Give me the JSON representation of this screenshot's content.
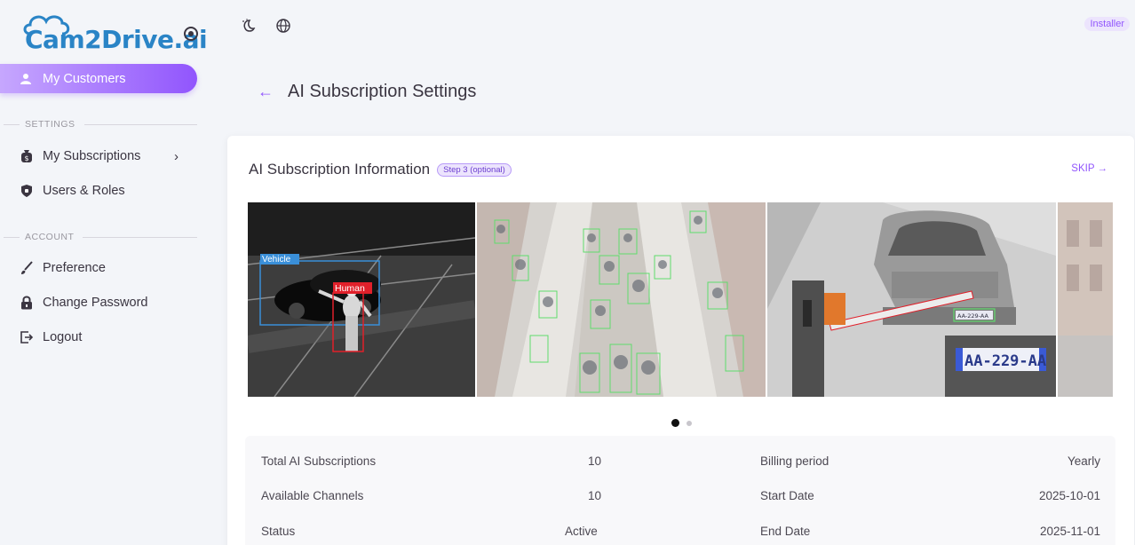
{
  "sidebar": {
    "logo_text": "Cam2Drive.ai",
    "active_item": "My Customers",
    "settings_label": "SETTINGS",
    "account_label": "ACCOUNT",
    "items": [
      {
        "label": "My Subscriptions",
        "icon": "money-bag-icon"
      },
      {
        "label": "Users & Roles",
        "icon": "shield-icon"
      },
      {
        "label": "Preference",
        "icon": "brush-icon"
      },
      {
        "label": "Change Password",
        "icon": "lock-icon"
      },
      {
        "label": "Logout",
        "icon": "logout-icon"
      }
    ]
  },
  "topbar": {
    "role_badge": "Installer"
  },
  "page": {
    "title": "AI Subscription Settings"
  },
  "card": {
    "title": "AI Subscription Information",
    "step_badge": "Step 3 (optional)",
    "skip_label": "SKIP →",
    "slides": [
      {
        "labels": [
          "Vehicle",
          "Human"
        ]
      },
      {
        "labels": []
      },
      {
        "labels": [
          "AA-229-AA"
        ]
      }
    ],
    "info": {
      "rows": [
        {
          "label1": "Total AI Subscriptions",
          "value1": "10",
          "label2": "Billing period",
          "value2": "Yearly"
        },
        {
          "label1": "Available Channels",
          "value1": "10",
          "label2": "Start Date",
          "value2": "2025-10-01"
        },
        {
          "label1": "Status",
          "value1": "Active",
          "label2": "End Date",
          "value2": "2025-11-01"
        }
      ]
    }
  },
  "colors": {
    "primary": "#9155fd",
    "logo_blue": "#2a84c6",
    "detect_blue": "#3a8fd8",
    "detect_red": "#e0202a",
    "detect_green": "#5fdc6c"
  }
}
